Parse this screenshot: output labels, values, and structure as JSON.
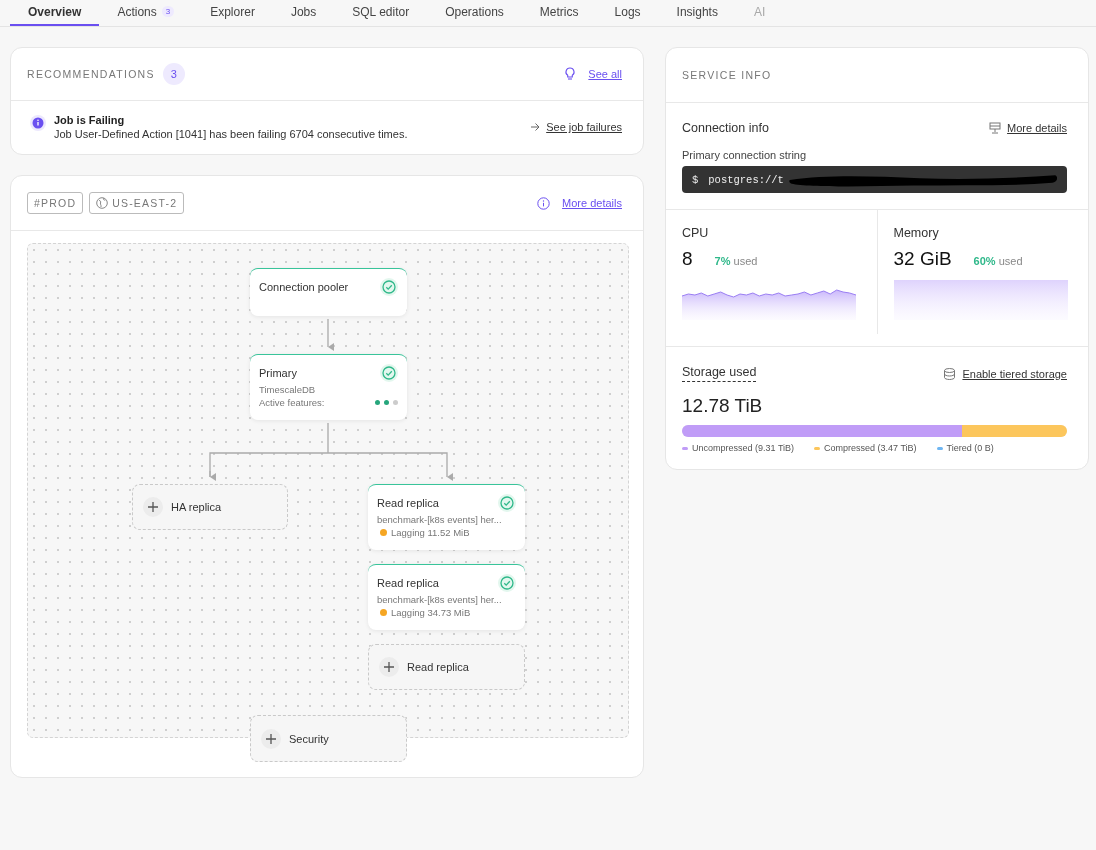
{
  "tabs": [
    {
      "label": "Overview",
      "selected": true,
      "disabled": false
    },
    {
      "label": "Actions",
      "badge": "3",
      "selected": false,
      "disabled": false
    },
    {
      "label": "Explorer",
      "selected": false,
      "disabled": false
    },
    {
      "label": "Jobs",
      "selected": false,
      "disabled": false
    },
    {
      "label": "SQL editor",
      "selected": false,
      "disabled": false
    },
    {
      "label": "Operations",
      "selected": false,
      "disabled": false
    },
    {
      "label": "Metrics",
      "selected": false,
      "disabled": false
    },
    {
      "label": "Logs",
      "selected": false,
      "disabled": false
    },
    {
      "label": "Insights",
      "selected": false,
      "disabled": false
    },
    {
      "label": "AI",
      "selected": false,
      "disabled": true
    }
  ],
  "recommendations": {
    "title": "RECOMMENDATIONS",
    "count": "3",
    "link": "See all",
    "items": [
      {
        "title": "Job is Failing",
        "message": "Job User-Defined Action [1041] has been failing 6704 consecutive times.",
        "action": "See job failures"
      }
    ]
  },
  "service": {
    "tags": [
      {
        "kind": "tag",
        "label": "#PROD"
      },
      {
        "kind": "region",
        "label": "US-EAST-2"
      }
    ],
    "link": "More details",
    "nodes": [
      {
        "kind": "node",
        "title": "Connection pooler",
        "healthy": true
      },
      {
        "kind": "node",
        "title": "Primary",
        "subtitle": "TimescaleDB",
        "features_label": "Active features:",
        "features": [
          {
            "on": true
          },
          {
            "on": true
          },
          {
            "on": false
          }
        ],
        "healthy": true
      },
      {
        "kind": "add",
        "title": "HA replica"
      },
      {
        "kind": "node",
        "title": "Read replica",
        "subtitle": "benchmark-[k8s events] her...",
        "status": "Lagging 11.52 MiB",
        "color": "#f5a623",
        "healthy": true
      },
      {
        "kind": "node",
        "title": "Read replica",
        "subtitle": "benchmark-[k8s events] her...",
        "status": "Lagging 34.73 MiB",
        "color": "#f5a623",
        "healthy": true
      },
      {
        "kind": "add",
        "title": "Read replica"
      },
      {
        "kind": "add",
        "title": "Security"
      }
    ]
  },
  "service_info": {
    "title": "SERVICE INFO",
    "connection": {
      "title": "Connection info",
      "link": "More details",
      "label": "Primary connection string",
      "prompt": "$",
      "value": "postgres://t"
    },
    "resources": [
      {
        "name": "CPU",
        "value": "8",
        "percent": "7%",
        "suffix": "used"
      },
      {
        "name": "Memory",
        "value": "32 GiB",
        "percent": "60%",
        "suffix": "used"
      }
    ],
    "storage": {
      "title": "Storage used",
      "link": "Enable tiered storage",
      "value": "12.78 TiB",
      "bar": [
        {
          "level": 0.728,
          "color": "#c09cf7"
        },
        {
          "level": 0.272,
          "color": "#fcc65c"
        }
      ],
      "legend": [
        {
          "label": "Uncompressed (9.31 TiB)",
          "color": "#c09cf7"
        },
        {
          "label": "Compressed (3.47 TiB)",
          "color": "#fcc65c"
        },
        {
          "label": "Tiered (0 B)",
          "color": "#6fb6f2"
        }
      ]
    }
  }
}
